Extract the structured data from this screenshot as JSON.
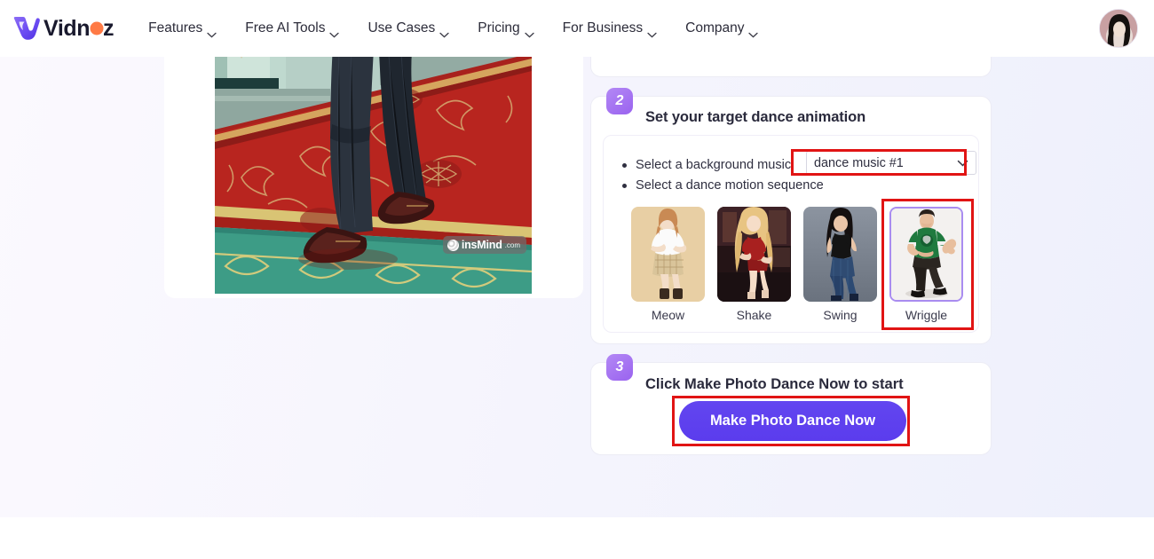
{
  "brand": {
    "name": "Vidnoz",
    "logo_icon": "vidnoz-v-logo",
    "accent_purple": "#5b3ced",
    "accent_orange": "#ff7a45"
  },
  "nav": {
    "items": [
      {
        "label": "Features",
        "icon": "chevron-down-icon"
      },
      {
        "label": "Free AI Tools",
        "icon": "chevron-down-icon"
      },
      {
        "label": "Use Cases",
        "icon": "chevron-down-icon"
      },
      {
        "label": "Pricing",
        "icon": "chevron-down-icon"
      },
      {
        "label": "For Business",
        "icon": "chevron-down-icon"
      },
      {
        "label": "Company",
        "icon": "chevron-down-icon"
      }
    ],
    "avatar_icon": "user-avatar"
  },
  "preview": {
    "image_alt": "Person in dark pinstripe suit walking on ornate red carpet",
    "watermark": {
      "icon": "insmind-logo-icon",
      "text": "insMind",
      "suffix": ".com"
    }
  },
  "step2": {
    "number": "2",
    "title": "Set your target dance animation",
    "bullets": [
      "Select a background music",
      "Select a dance motion sequence"
    ],
    "music_select": {
      "value": "dance music #1",
      "placeholder": "dance music #1",
      "icon": "chevron-down-icon"
    },
    "motions": [
      {
        "label": "Meow",
        "selected": false
      },
      {
        "label": "Shake",
        "selected": false
      },
      {
        "label": "Swing",
        "selected": false
      },
      {
        "label": "Wriggle",
        "selected": true
      }
    ]
  },
  "step3": {
    "number": "3",
    "title": "Click Make Photo Dance Now to start",
    "cta_label": "Make Photo Dance Now"
  },
  "annotations": {
    "color": "#e11414",
    "targets": [
      "music-select",
      "wriggle-thumbnail",
      "make-photo-dance-now-button"
    ]
  }
}
